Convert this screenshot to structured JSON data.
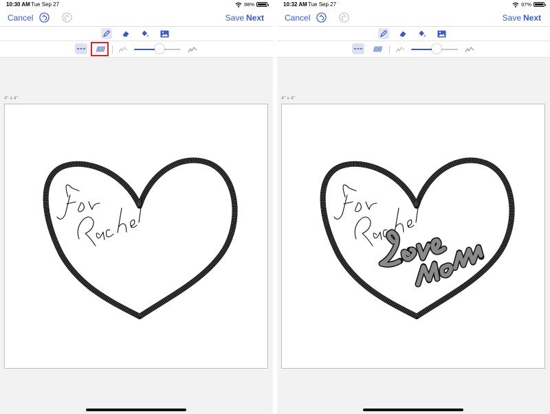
{
  "screens": [
    {
      "status": {
        "time": "10:30 AM",
        "date": "Tue Sep 27",
        "battery": "98%",
        "battery_level": 0.98
      },
      "nav": {
        "cancel": "Cancel",
        "save": "Save",
        "next": "Next"
      },
      "hoop_label": "4\" x 4\"",
      "slider_value": 0.55
    },
    {
      "status": {
        "time": "10:32 AM",
        "date": "Tue Sep 27",
        "battery": "97%",
        "battery_level": 0.97
      },
      "nav": {
        "cancel": "Cancel",
        "save": "Save",
        "next": "Next"
      },
      "hoop_label": "4\" x 4\"",
      "slider_value": 0.55
    }
  ],
  "toolbar_icons": [
    "pencil-icon",
    "eraser-icon",
    "fill-icon",
    "image-icon"
  ],
  "stitch_icons": [
    "dashed-stitch-icon",
    "zigzag-stitch-icon",
    "thin-line-icon",
    "thick-line-icon"
  ],
  "colors": {
    "accent": "#3a59c4",
    "highlight": "#e0202a",
    "stitch": "#111111"
  }
}
